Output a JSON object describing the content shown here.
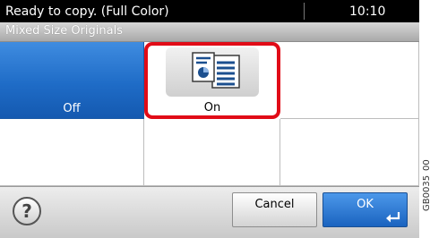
{
  "status_bar": {
    "message": "Ready to copy. (Full Color)",
    "time": "10:10"
  },
  "title_bar": {
    "title": "Mixed Size Originals"
  },
  "options": {
    "off_label": "Off",
    "on_label": "On",
    "on_icon": "mixed-size-originals-icon",
    "selected": "Off",
    "highlighted": "On"
  },
  "bottom_bar": {
    "help_symbol": "?",
    "help_icon": "help-icon",
    "cancel_label": "Cancel",
    "ok_label": "OK",
    "ok_icon": "enter-icon"
  },
  "side_code": "GB0035_00",
  "colors": {
    "selected_blue": "#1f6cc7",
    "highlight_red": "#e10b17",
    "status_bar_bg": "#000000"
  }
}
